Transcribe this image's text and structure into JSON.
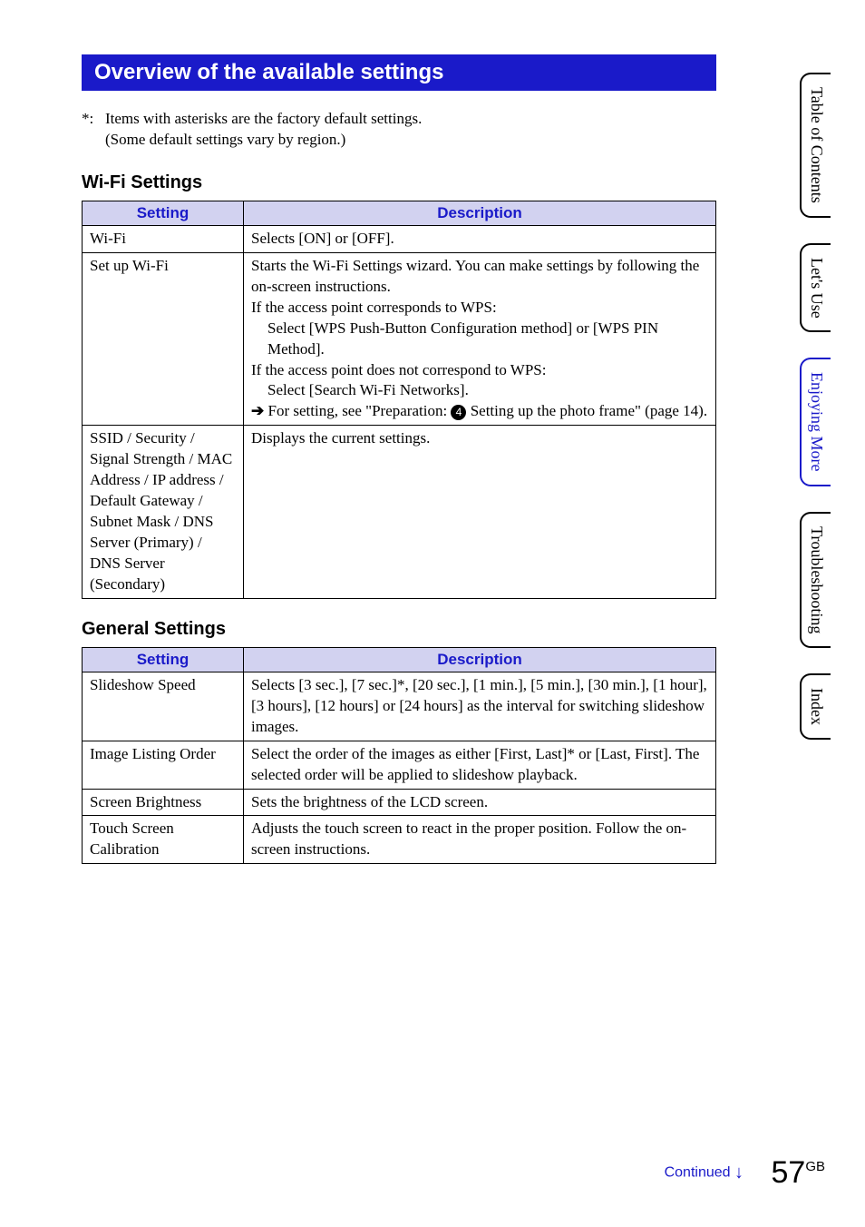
{
  "header": {
    "title": "Overview of the available settings"
  },
  "note": {
    "asterisk": "*:",
    "line1": "Items with asterisks are the factory default settings.",
    "line2": "(Some default settings vary by region.)"
  },
  "wifi": {
    "heading": "Wi-Fi Settings",
    "col_setting": "Setting",
    "col_description": "Description",
    "rows": {
      "r0": {
        "setting": "Wi-Fi",
        "desc": "Selects [ON] or [OFF]."
      },
      "r1": {
        "setting": "Set up Wi-Fi",
        "d1": "Starts the Wi-Fi Settings wizard. You can make settings by following the on-screen instructions.",
        "d2": "If the access point corresponds to WPS:",
        "d3": "Select [WPS Push-Button Configuration method] or [WPS PIN Method].",
        "d4": "If the access point does not correspond to WPS:",
        "d5": "Select [Search Wi-Fi Networks].",
        "d6a": "For setting, see \"Preparation:",
        "d6num": "4",
        "d6b": "Setting up the photo frame\" (page 14)."
      },
      "r2": {
        "setting": "SSID / Security / Signal Strength / MAC Address / IP address / Default Gateway / Subnet Mask  / DNS Server (Primary) / DNS Server (Secondary)",
        "desc": "Displays the current settings."
      }
    }
  },
  "general": {
    "heading": "General Settings",
    "col_setting": "Setting",
    "col_description": "Description",
    "rows": {
      "r0": {
        "setting": "Slideshow Speed",
        "desc": "Selects [3 sec.], [7 sec.]*, [20 sec.], [1 min.], [5 min.], [30 min.], [1 hour], [3 hours], [12 hours] or [24 hours] as the interval for switching slideshow images."
      },
      "r1": {
        "setting": "Image Listing Order",
        "desc": "Select the order of the images as either [First, Last]* or [Last, First]. The selected order will be applied to slideshow playback."
      },
      "r2": {
        "setting": "Screen Brightness",
        "desc": "Sets the brightness of the LCD screen."
      },
      "r3": {
        "setting": "Touch Screen Calibration",
        "desc": "Adjusts the touch screen to react in the proper position. Follow the on-screen instructions."
      }
    }
  },
  "tabs": {
    "t0": "Table of Contents",
    "t1": "Let's Use",
    "t2": "Enjoying More",
    "t3": "Troubleshooting",
    "t4": "Index"
  },
  "footer": {
    "continued": "Continued",
    "page_big": "57",
    "page_small": "GB"
  }
}
